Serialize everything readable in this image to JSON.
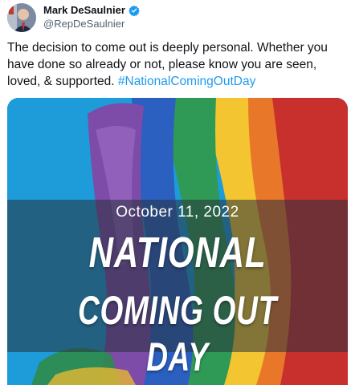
{
  "author": {
    "name": "Mark DeSaulnier",
    "handle": "@RepDeSaulnier",
    "verified_icon": "verified-badge-icon",
    "badge_color": "#1d9bf0"
  },
  "tweet": {
    "text_plain": "The decision to come out is deeply personal. Whether you have done so already or not, please know you are seen, loved, & supported. ",
    "hashtag": "#NationalComingOutDay",
    "link_color": "#1d9bf0"
  },
  "media": {
    "date": "October 11, 2022",
    "title_line1": "NATIONAL",
    "title_line2": "COMING OUT DAY",
    "background_color": "#1e9bd9"
  }
}
